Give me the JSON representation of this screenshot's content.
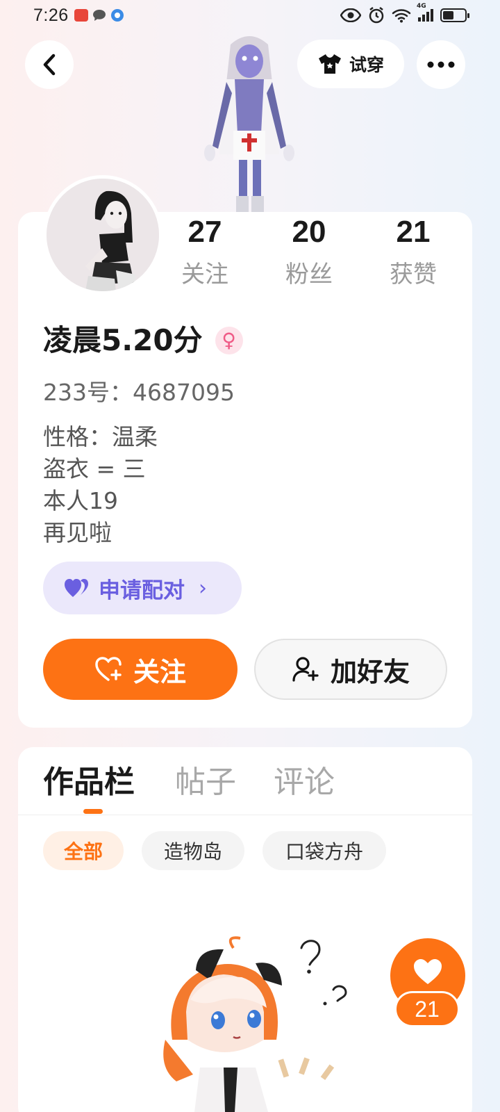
{
  "status_bar": {
    "time": "7:26",
    "network": "4G"
  },
  "header": {
    "back_icon": "chevron-left-icon",
    "try_on_label": "试穿",
    "try_on_icon": "tshirt-icon",
    "more_icon": "more-dots-icon"
  },
  "profile": {
    "stats": [
      {
        "value": "27",
        "label": "关注"
      },
      {
        "value": "20",
        "label": "粉丝"
      },
      {
        "value": "21",
        "label": "获赞"
      }
    ],
    "username": "凌晨5.20分",
    "gender_symbol": "♀",
    "uid": "233号：4687095",
    "bio_lines": [
      "性格：温柔",
      "盗衣 = 三",
      "本人19",
      "再见啦"
    ],
    "pair_button": "申请配对",
    "pair_chevron": "›",
    "follow_button": "关注",
    "add_friend_button": "加好友"
  },
  "works": {
    "tabs": [
      "作品栏",
      "帖子",
      "评论"
    ],
    "active_tab": 0,
    "filters": [
      "全部",
      "造物岛",
      "口袋方舟"
    ],
    "active_filter": 0,
    "like_count": "21"
  },
  "colors": {
    "accent": "#fd7214",
    "pair_purple": "#6a5fe0",
    "gender_pink": "#ef5a86"
  }
}
